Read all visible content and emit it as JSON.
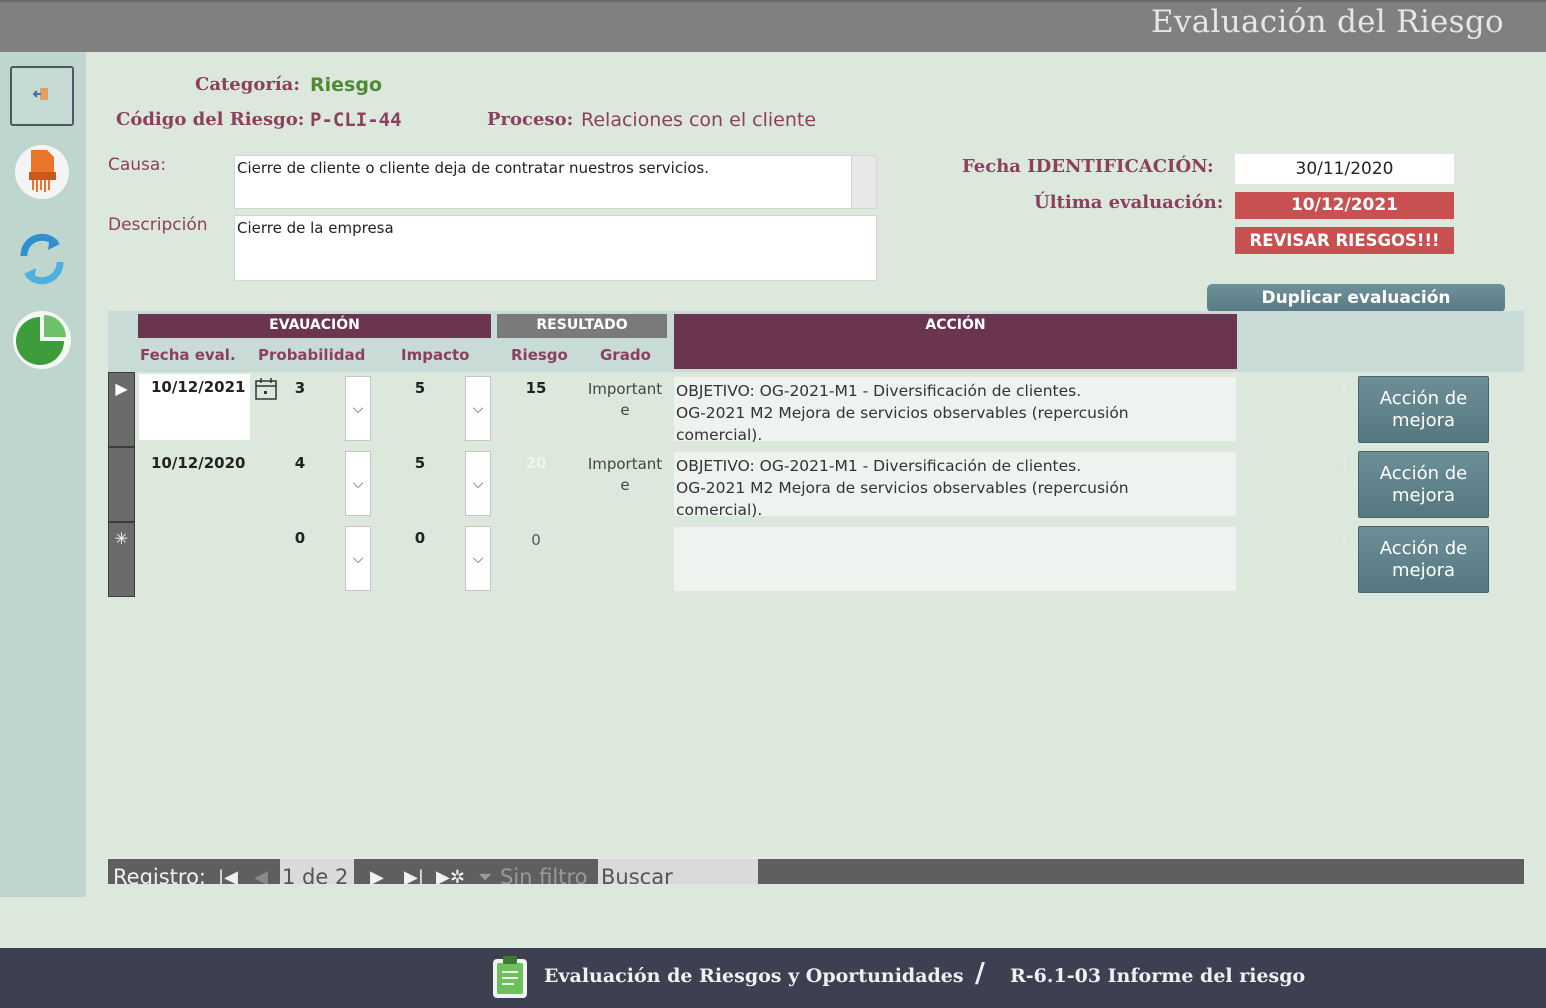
{
  "window": {
    "title": "Evaluación del Riesgo"
  },
  "sidebar": {
    "items": [
      {
        "icon": "exit-icon"
      },
      {
        "icon": "pdf-report-icon"
      },
      {
        "icon": "refresh-icon"
      },
      {
        "icon": "pie-chart-icon"
      }
    ]
  },
  "header": {
    "categoria_label": "Categoría:",
    "categoria_value": "Riesgo",
    "codigo_label": "Código del Riesgo:",
    "codigo_value": "P-CLI-44",
    "proceso_label": "Proceso:",
    "proceso_value": "Relaciones con el cliente"
  },
  "causa": {
    "label": "Causa:",
    "value": "Cierre de cliente o cliente deja de contratar nuestros servicios."
  },
  "descripcion": {
    "label": "Descripción",
    "value": "Cierre de la empresa"
  },
  "fechas": {
    "identificacion_label": "Fecha IDENTIFICACIÓN:",
    "identificacion_value": "30/11/2020",
    "ultima_label": "Última evaluación:",
    "ultima_value": "10/12/2021",
    "alert": "REVISAR RIESGOS!!!"
  },
  "duplicate_button": "Duplicar evaluación",
  "grid": {
    "group_headers": {
      "evaluacion": "EVAUACIÓN",
      "resultado": "RESULTADO",
      "accion": "ACCIÓN"
    },
    "columns": {
      "fecha": "Fecha eval.",
      "probabilidad": "Probabilidad",
      "impacto": "Impacto",
      "riesgo": "Riesgo",
      "grado": "Grado"
    },
    "rows": [
      {
        "fecha": "10/12/2021",
        "probabilidad": "3",
        "impacto": "5",
        "riesgo": "15",
        "grado": "Important\ne",
        "accion": "OBJETIVO: OG-2021-M1 - Diversificación de clientes.\nOG-2021 M2 Mejora de servicios observables (repercusión\ncomercial).",
        "button": "Acción de\nmejora"
      },
      {
        "fecha": "10/12/2020",
        "probabilidad": "4",
        "impacto": "5",
        "riesgo": "20",
        "grado": "Important\ne",
        "accion": "OBJETIVO: OG-2021-M1 - Diversificación de clientes.\nOG-2021 M2 Mejora de servicios observables (repercusión\ncomercial).",
        "button": "Acción de\nmejora"
      },
      {
        "fecha": "",
        "probabilidad": "0",
        "impacto": "0",
        "riesgo": "0",
        "grado": "",
        "accion": "",
        "button": "Acción de\nmejora"
      }
    ]
  },
  "navigation": {
    "registro_label": "Registro:",
    "position": "1 de 2",
    "filter": "Sin filtro",
    "search_placeholder": "Buscar"
  },
  "footer": {
    "app_name": "Evaluación de Riesgos y Oportunidades",
    "separator": "/",
    "report": "R-6.1-03 Informe del riesgo"
  }
}
